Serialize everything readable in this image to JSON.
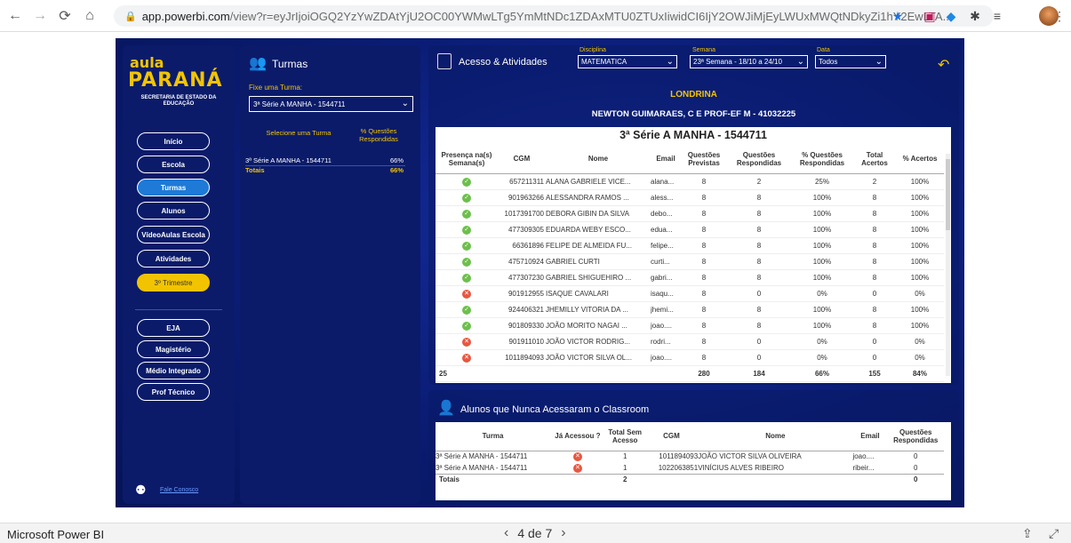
{
  "browser": {
    "url_host": "app.powerbi.com",
    "url_path": "/view?r=eyJrIjoiOGQ2YzYwZDAtYjU2OC00YWMwLTg5YmMtNDc1ZDAxMTU0ZTUxIiwidCI6IjY2OWJiMjEyLWUxMWQtNDkyZi1hY2EwLTA..."
  },
  "leftnav": {
    "logo_aula": "aula",
    "logo_parana": "PARANÁ",
    "logo_sec": "SECRETARIA DE ESTADO DA EDUCAÇÃO",
    "items": [
      "Início",
      "Escola",
      "Turmas",
      "Alunos",
      "VídeoAulas Escola",
      "Atividades",
      "3º Trimestre",
      "EJA",
      "Magistério",
      "Médio Integrado",
      "Prof Técnico"
    ],
    "fale": "Fale Conosco"
  },
  "turmas": {
    "title": "Turmas",
    "fixe_label": "Fixe uma Turma:",
    "selected": "3ª Série A MANHA - 1544711",
    "col1": "Selecione uma Turma",
    "col2": "% Questões Respondidas",
    "rows": [
      {
        "turma": "3ª Série A MANHA - 1544711",
        "pct": "66%"
      }
    ],
    "total_label": "Totais",
    "total_pct": "66%"
  },
  "acesso": {
    "title": "Acesso & Atividades",
    "disciplina_label": "Disciplina",
    "disciplina": "MATEMATICA",
    "semana_label": "Semana",
    "semana": "23ª Semana - 18/10 a 24/10",
    "data_label": "Data",
    "data": "Todos",
    "city": "LONDRINA",
    "school": "NEWTON GUIMARAES, C E PROF-EF M - 41032225",
    "table_title": "3ª Série A MANHA - 1544711",
    "headers": [
      "Presença na(s) Semana(s)",
      "CGM",
      "Nome",
      "Email",
      "Questões Previstas",
      "Questões Respondidas",
      "% Questões Respondidas",
      "Total Acertos",
      "% Acertos"
    ],
    "rows": [
      {
        "p": "ok",
        "cgm": "657211311",
        "nome": "ALANA GABRIELE VICE...",
        "email": "alana...",
        "prev": "8",
        "resp": "2",
        "pct": "25%",
        "acertos": "2",
        "pac": "100%"
      },
      {
        "p": "ok",
        "cgm": "901963266",
        "nome": "ALESSANDRA RAMOS ...",
        "email": "aless...",
        "prev": "8",
        "resp": "8",
        "pct": "100%",
        "acertos": "8",
        "pac": "100%"
      },
      {
        "p": "ok",
        "cgm": "1017391700",
        "nome": "DEBORA GIBIN DA SILVA",
        "email": "debo...",
        "prev": "8",
        "resp": "8",
        "pct": "100%",
        "acertos": "8",
        "pac": "100%"
      },
      {
        "p": "ok",
        "cgm": "477309305",
        "nome": "EDUARDA WEBY ESCO...",
        "email": "edua...",
        "prev": "8",
        "resp": "8",
        "pct": "100%",
        "acertos": "8",
        "pac": "100%"
      },
      {
        "p": "ok",
        "cgm": "66361896",
        "nome": "FELIPE DE ALMEIDA FU...",
        "email": "felipe...",
        "prev": "8",
        "resp": "8",
        "pct": "100%",
        "acertos": "8",
        "pac": "100%"
      },
      {
        "p": "ok",
        "cgm": "475710924",
        "nome": "GABRIEL CURTI",
        "email": "curti...",
        "prev": "8",
        "resp": "8",
        "pct": "100%",
        "acertos": "8",
        "pac": "100%"
      },
      {
        "p": "ok",
        "cgm": "477307230",
        "nome": "GABRIEL SHIGUEHIRO ...",
        "email": "gabri...",
        "prev": "8",
        "resp": "8",
        "pct": "100%",
        "acertos": "8",
        "pac": "100%"
      },
      {
        "p": "no",
        "cgm": "901912955",
        "nome": "ISAQUE CAVALARI",
        "email": "isaqu...",
        "prev": "8",
        "resp": "0",
        "pct": "0%",
        "acertos": "0",
        "pac": "0%"
      },
      {
        "p": "ok",
        "cgm": "924406321",
        "nome": "JHEMILLY VITORIA DA ...",
        "email": "jhemi...",
        "prev": "8",
        "resp": "8",
        "pct": "100%",
        "acertos": "8",
        "pac": "100%"
      },
      {
        "p": "ok",
        "cgm": "901809330",
        "nome": "JOÃO MORITO NAGAI ...",
        "email": "joao....",
        "prev": "8",
        "resp": "8",
        "pct": "100%",
        "acertos": "8",
        "pac": "100%"
      },
      {
        "p": "no",
        "cgm": "901911010",
        "nome": "JOÃO VICTOR RODRIG...",
        "email": "rodri...",
        "prev": "8",
        "resp": "0",
        "pct": "0%",
        "acertos": "0",
        "pac": "0%"
      },
      {
        "p": "no",
        "cgm": "1011894093",
        "nome": "JOÃO VICTOR SILVA OL...",
        "email": "joao....",
        "prev": "8",
        "resp": "0",
        "pct": "0%",
        "acertos": "0",
        "pac": "0%"
      }
    ],
    "totals": {
      "p": "25",
      "prev": "280",
      "resp": "184",
      "pct": "66%",
      "acertos": "155",
      "pac": "84%"
    }
  },
  "never": {
    "title": "Alunos que Nunca Acessaram o Classroom",
    "headers": [
      "Turma",
      "Já Acessou ?",
      "Total Sem Acesso",
      "CGM",
      "Nome",
      "Email",
      "Questões Respondidas"
    ],
    "rows": [
      {
        "turma": "3ª Série A MANHA - 1544711",
        "total": "1",
        "cgm": "1011894093",
        "nome": "JOÃO VICTOR SILVA OLIVEIRA",
        "email": "joao....",
        "q": "0"
      },
      {
        "turma": "3ª Série A MANHA - 1544711",
        "total": "1",
        "cgm": "1022063851",
        "nome": "VINÍCIUS ALVES RIBEIRO",
        "email": "ribeir...",
        "q": "0"
      }
    ],
    "total_label": "Totais",
    "total_sem": "2",
    "total_q": "0"
  },
  "bottom": {
    "app": "Microsoft Power BI",
    "page": "4 de 7"
  }
}
